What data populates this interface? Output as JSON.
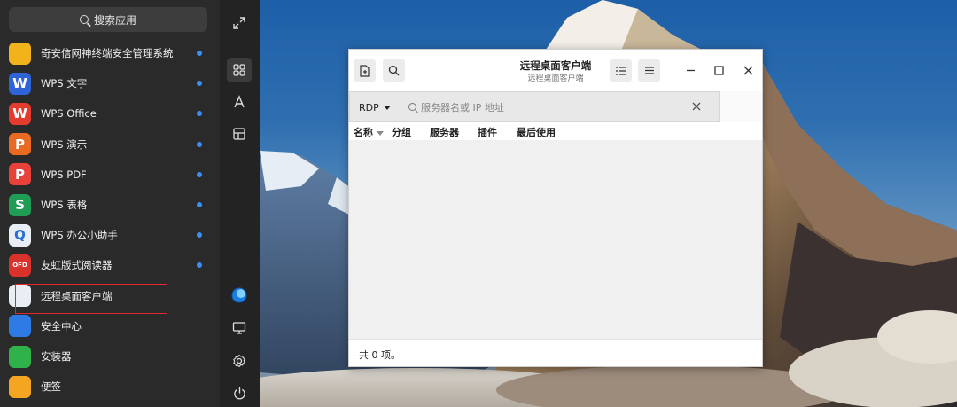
{
  "launcher": {
    "search_placeholder": "搜索应用",
    "apps": [
      {
        "label": "奇安信网神终端安全管理系统",
        "icon": "qianxin-icon",
        "color": "#f2b21a",
        "glyph": "",
        "dot": true
      },
      {
        "label": "WPS 文字",
        "icon": "wps-writer-icon",
        "color": "#2f64d8",
        "glyph": "W",
        "dot": true
      },
      {
        "label": "WPS Office",
        "icon": "wps-office-icon",
        "color": "#e33b2e",
        "glyph": "W",
        "dot": true
      },
      {
        "label": "WPS 演示",
        "icon": "wps-presentation-icon",
        "color": "#ea6a22",
        "glyph": "P",
        "dot": true
      },
      {
        "label": "WPS PDF",
        "icon": "wps-pdf-icon",
        "color": "#e8413a",
        "glyph": "P",
        "dot": true
      },
      {
        "label": "WPS 表格",
        "icon": "wps-spreadsheet-icon",
        "color": "#1f9d55",
        "glyph": "S",
        "dot": true
      },
      {
        "label": "WPS 办公小助手",
        "icon": "wps-assistant-icon",
        "color": "#e9eef5",
        "glyph": "Q",
        "dot": true
      },
      {
        "label": "友虹版式阅读器",
        "icon": "ofd-reader-icon",
        "color": "#d9322c",
        "glyph": "OFD",
        "dot": true
      },
      {
        "label": "远程桌面客户端",
        "icon": "remote-desktop-icon",
        "color": "#e9eef5",
        "glyph": "",
        "dot": false
      },
      {
        "label": "安全中心",
        "icon": "security-center-icon",
        "color": "#2e7be6",
        "glyph": "",
        "dot": false
      },
      {
        "label": "安装器",
        "icon": "installer-icon",
        "color": "#2fb24a",
        "glyph": "",
        "dot": false
      },
      {
        "label": "便签",
        "icon": "notes-icon",
        "color": "#f4a521",
        "glyph": "",
        "dot": false
      }
    ]
  },
  "window": {
    "title": "远程桌面客户端",
    "subtitle": "远程桌面客户端",
    "protocol": "RDP",
    "server_placeholder": "服务器名或 IP 地址",
    "server_value": "",
    "columns": [
      "名称",
      "分组",
      "服务器",
      "插件",
      "最后使用"
    ],
    "status": "共 0 项。"
  }
}
